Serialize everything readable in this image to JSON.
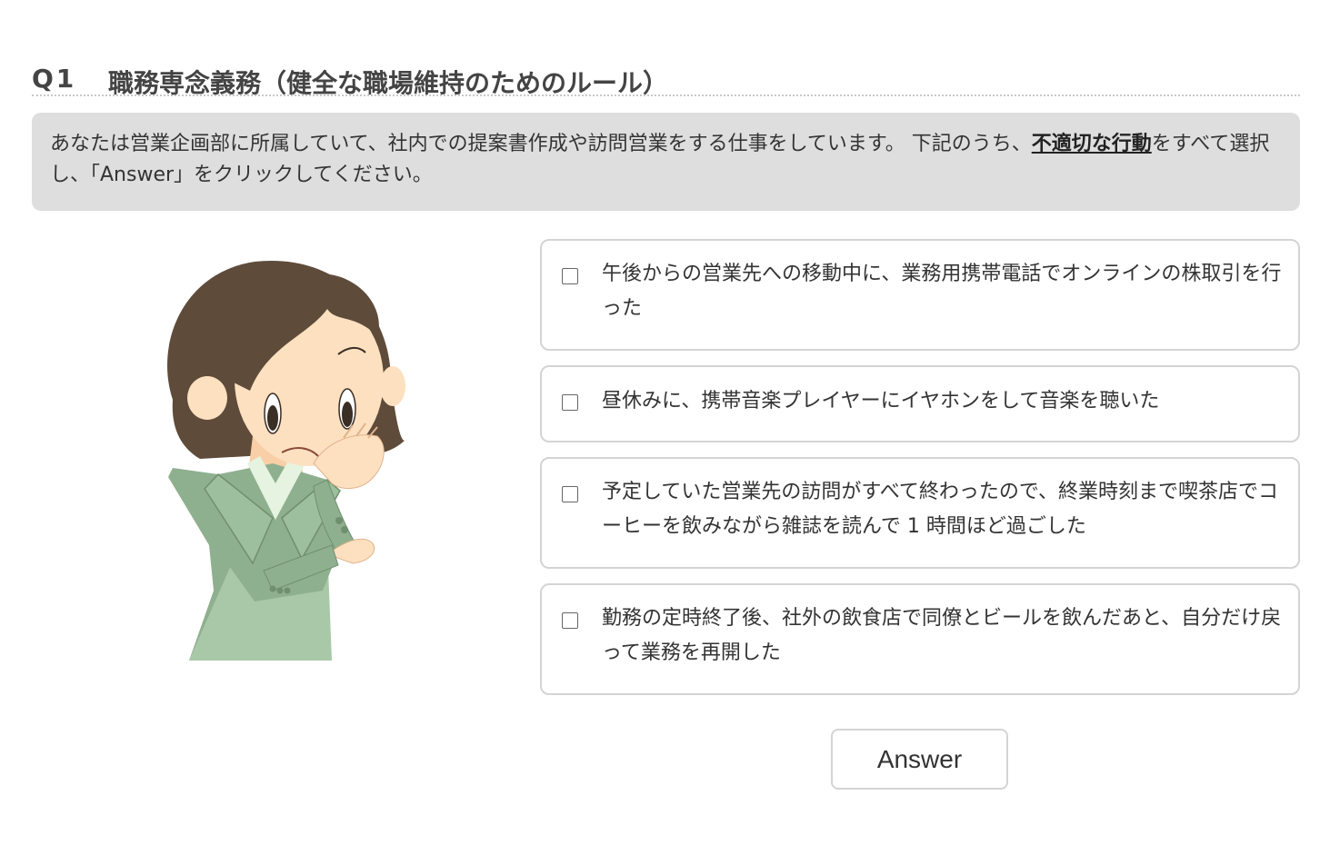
{
  "question": {
    "number": "Q1",
    "title": "職務専念義務（健全な職場維持のためのルール）"
  },
  "instruction": {
    "text_before": "あなたは営業企画部に所属していて、社内での提案書作成や訪問営業をする仕事をしています。 下記のうち、",
    "emphasis": "不適切な行動",
    "text_after": "をすべて選択し、「Answer」をクリックしてください。"
  },
  "illustration": {
    "icon": "woman-thinking-illustration",
    "colors": {
      "hair": "#5e4b3a",
      "skin": "#fde0c0",
      "suit": "#8fb08f",
      "suit_light": "#a8c8a8",
      "blouse": "#e6f3e0"
    }
  },
  "options": [
    {
      "label": "午後からの営業先への移動中に、業務用携帯電話でオンラインの株取引を行った",
      "checked": false
    },
    {
      "label": "昼休みに、携帯音楽プレイヤーにイヤホンをして音楽を聴いた",
      "checked": false
    },
    {
      "label": "予定していた営業先の訪問がすべて終わったので、終業時刻まで喫茶店でコーヒーを飲みながら雑誌を読んで 1 時間ほど過ごした",
      "checked": false
    },
    {
      "label": "勤務の定時終了後、社外の飲食店で同僚とビールを飲んだあと、自分だけ戻って業務を再開した",
      "checked": false
    }
  ],
  "answer_button": {
    "label": "Answer"
  }
}
